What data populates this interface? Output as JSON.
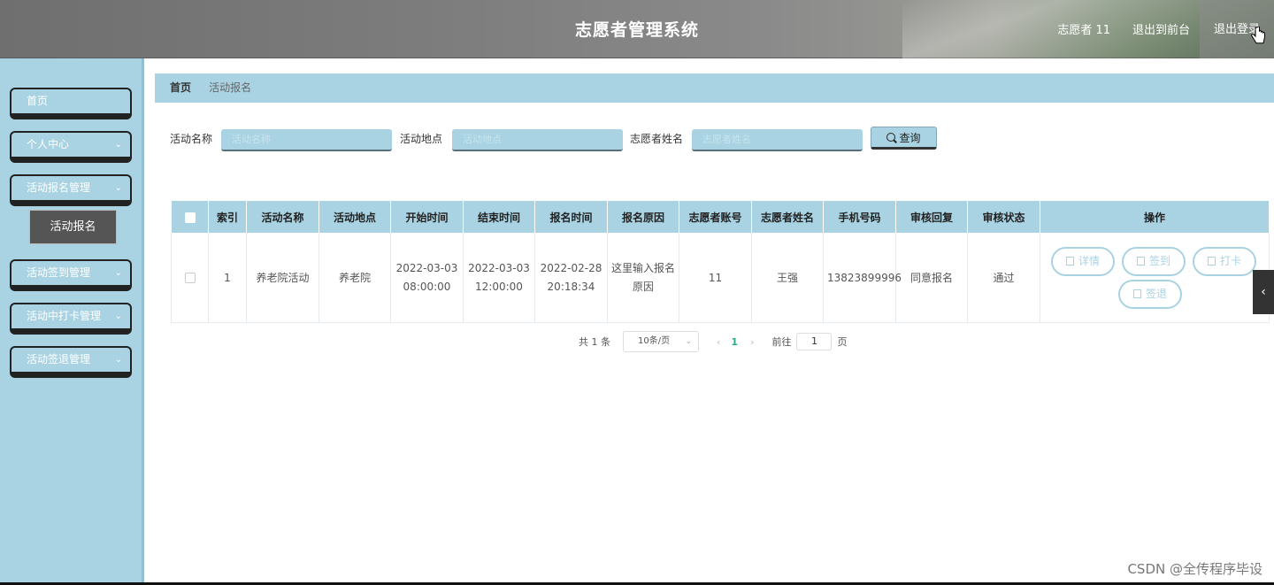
{
  "header": {
    "title": "志愿者管理系统",
    "user": "志愿者 11",
    "front_link": "退出到前台",
    "logout": "退出登录"
  },
  "sidebar": {
    "items": [
      {
        "label": "首页"
      },
      {
        "label": "个人中心"
      },
      {
        "label": "活动报名管理"
      },
      {
        "label": "活动签到管理"
      },
      {
        "label": "活动中打卡管理"
      },
      {
        "label": "活动签退管理"
      }
    ],
    "submenu": {
      "label": "活动报名"
    }
  },
  "breadcrumb": {
    "home": "首页",
    "current": "活动报名"
  },
  "search": {
    "activity_name_label": "活动名称",
    "activity_name_placeholder": "活动名称",
    "location_label": "活动地点",
    "location_placeholder": "活动地点",
    "volunteer_name_label": "志愿者姓名",
    "volunteer_name_placeholder": "志愿者姓名",
    "query_button": "查询"
  },
  "table": {
    "headers": [
      "索引",
      "活动名称",
      "活动地点",
      "开始时间",
      "结束时间",
      "报名时间",
      "报名原因",
      "志愿者账号",
      "志愿者姓名",
      "手机号码",
      "审核回复",
      "审核状态",
      "操作"
    ],
    "rows": [
      {
        "index": "1",
        "activity_name": "养老院活动",
        "location": "养老院",
        "start_time": "2022-03-03 08:00:00",
        "end_time": "2022-03-03 12:00:00",
        "signup_time": "2022-02-28 20:18:34",
        "reason": "这里输入报名原因",
        "account": "11",
        "name": "王强",
        "phone": "13823899996",
        "reply": "同意报名",
        "status": "通过",
        "actions": [
          "详情",
          "签到",
          "打卡",
          "签退"
        ]
      }
    ]
  },
  "pagination": {
    "total": "共 1 条",
    "page_size": "10条/页",
    "current_page": "1",
    "goto_label": "前往",
    "goto_value": "1",
    "page_suffix": "页"
  },
  "watermark": "CSDN @全传程序毕设"
}
